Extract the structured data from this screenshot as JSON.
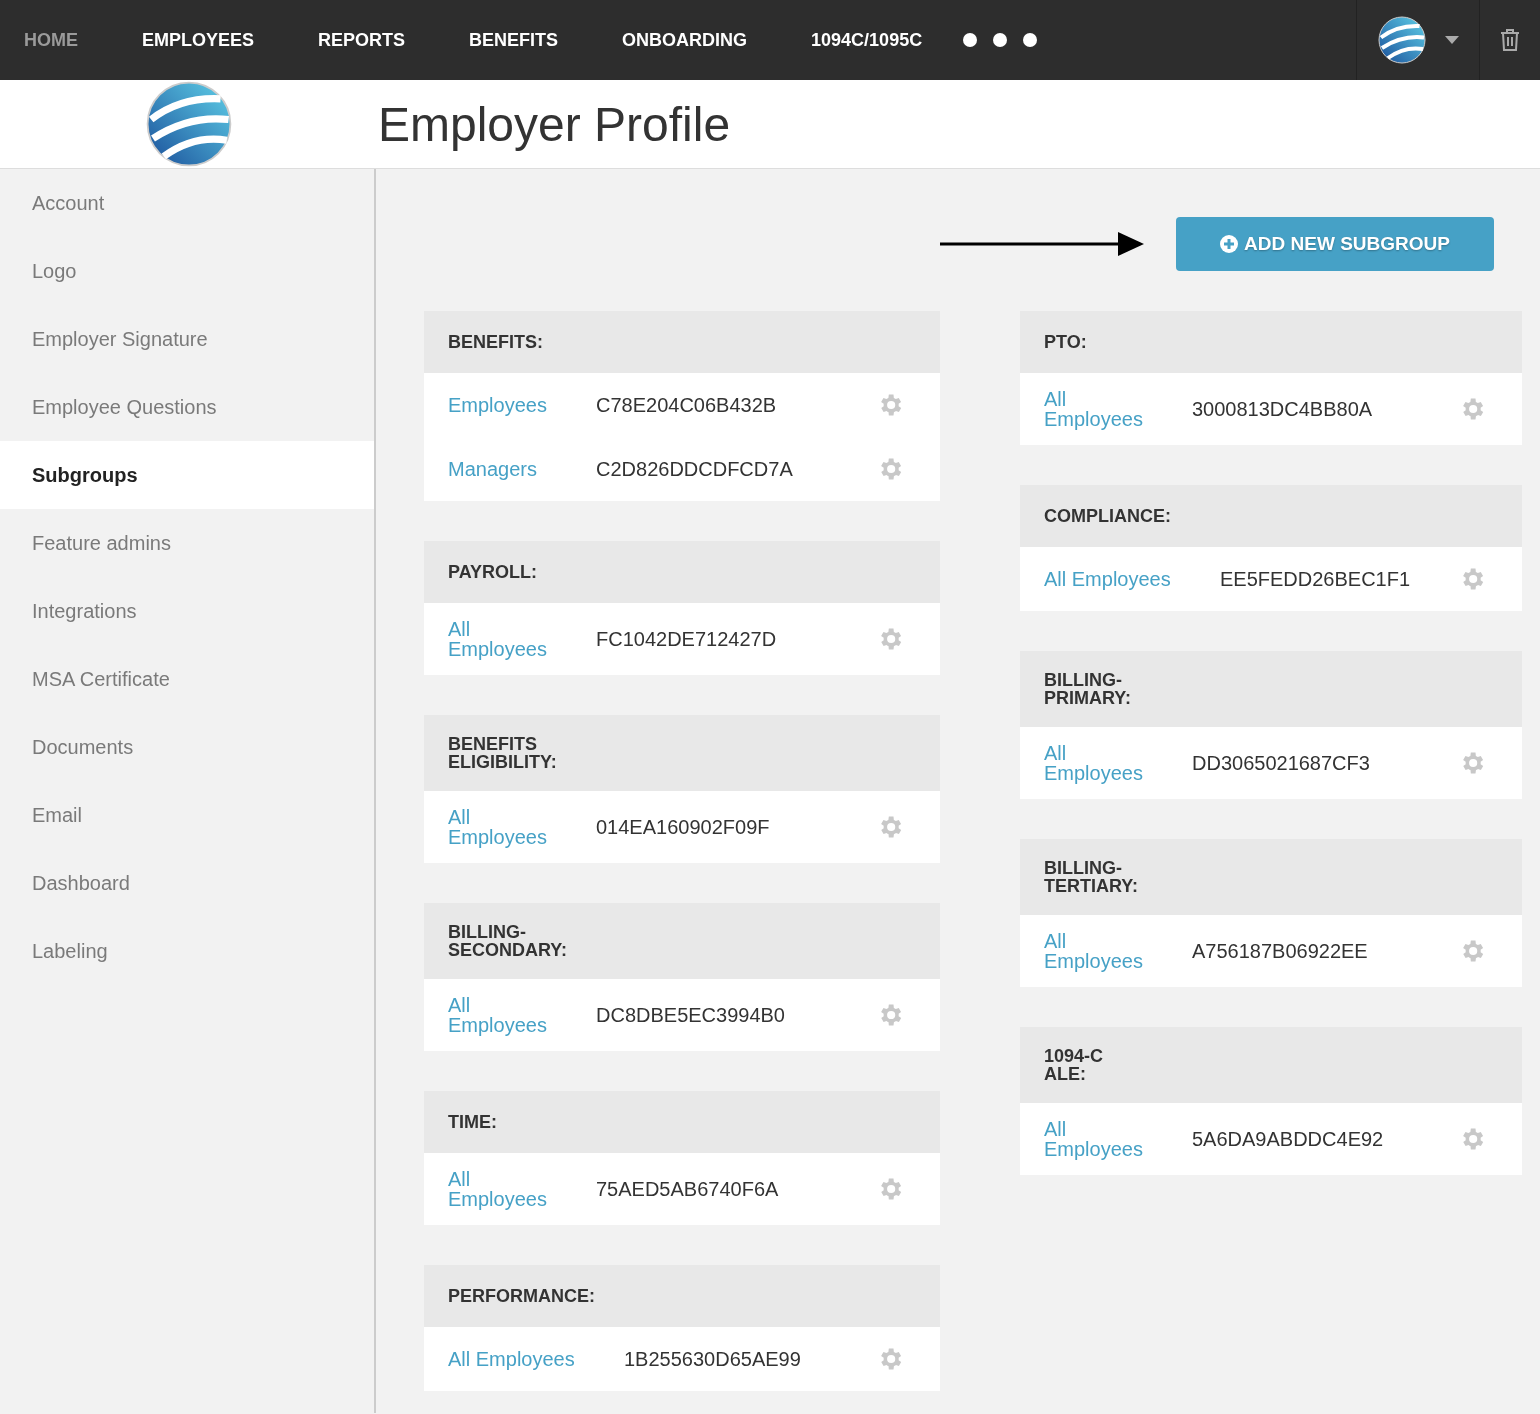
{
  "nav": {
    "items": [
      {
        "label": "HOME",
        "disabled": true
      },
      {
        "label": "EMPLOYEES",
        "disabled": false
      },
      {
        "label": "REPORTS",
        "disabled": false
      },
      {
        "label": "BENEFITS",
        "disabled": false
      },
      {
        "label": "ONBOARDING",
        "disabled": false
      },
      {
        "label": "1094C/1095C",
        "disabled": false
      }
    ]
  },
  "page_title": "Employer Profile",
  "sidebar": {
    "items": [
      {
        "label": "Account",
        "selected": false
      },
      {
        "label": "Logo",
        "selected": false
      },
      {
        "label": "Employer Signature",
        "selected": false
      },
      {
        "label": "Employee Questions",
        "selected": false
      },
      {
        "label": "Subgroups",
        "selected": true
      },
      {
        "label": "Feature admins",
        "selected": false
      },
      {
        "label": "Integrations",
        "selected": false
      },
      {
        "label": "MSA Certificate",
        "selected": false
      },
      {
        "label": "Documents",
        "selected": false
      },
      {
        "label": "Email",
        "selected": false
      },
      {
        "label": "Dashboard",
        "selected": false
      },
      {
        "label": "Labeling",
        "selected": false
      }
    ]
  },
  "add_button": "ADD NEW SUBGROUP",
  "columns": [
    [
      {
        "name": "BENEFITS:",
        "rows": [
          {
            "group": "Employees",
            "code": "C78E204C06B432B"
          },
          {
            "group": "Managers",
            "code": "C2D826DDCDFCD7A"
          }
        ]
      },
      {
        "name": "PAYROLL:",
        "rows": [
          {
            "group": "All\nEmployees",
            "code": "FC1042DE712427D"
          }
        ]
      },
      {
        "name": "BENEFITS\nELIGIBILITY:",
        "rows": [
          {
            "group": "All\nEmployees",
            "code": "014EA160902F09F"
          }
        ]
      },
      {
        "name": "BILLING-\nSECONDARY:",
        "rows": [
          {
            "group": "All\nEmployees",
            "code": "DC8DBE5EC3994B0"
          }
        ]
      },
      {
        "name": "TIME:",
        "rows": [
          {
            "group": "All\nEmployees",
            "code": "75AED5AB6740F6A"
          }
        ]
      },
      {
        "name": "PERFORMANCE:",
        "rows": [
          {
            "group": "All Employees",
            "code": "1B255630D65AE99"
          }
        ]
      }
    ],
    [
      {
        "name": "PTO:",
        "rows": [
          {
            "group": "All\nEmployees",
            "code": "3000813DC4BB80A"
          }
        ]
      },
      {
        "name": "COMPLIANCE:",
        "rows": [
          {
            "group": "All Employees",
            "code": "EE5FEDD26BEC1F1"
          }
        ]
      },
      {
        "name": "BILLING-\nPRIMARY:",
        "rows": [
          {
            "group": "All\nEmployees",
            "code": "DD3065021687CF3"
          }
        ]
      },
      {
        "name": "BILLING-\nTERTIARY:",
        "rows": [
          {
            "group": "All\nEmployees",
            "code": "A756187B06922EE"
          }
        ]
      },
      {
        "name": "1094-C\nALE:",
        "rows": [
          {
            "group": "All\nEmployees",
            "code": "5A6DA9ABDDC4E92"
          }
        ]
      }
    ]
  ]
}
